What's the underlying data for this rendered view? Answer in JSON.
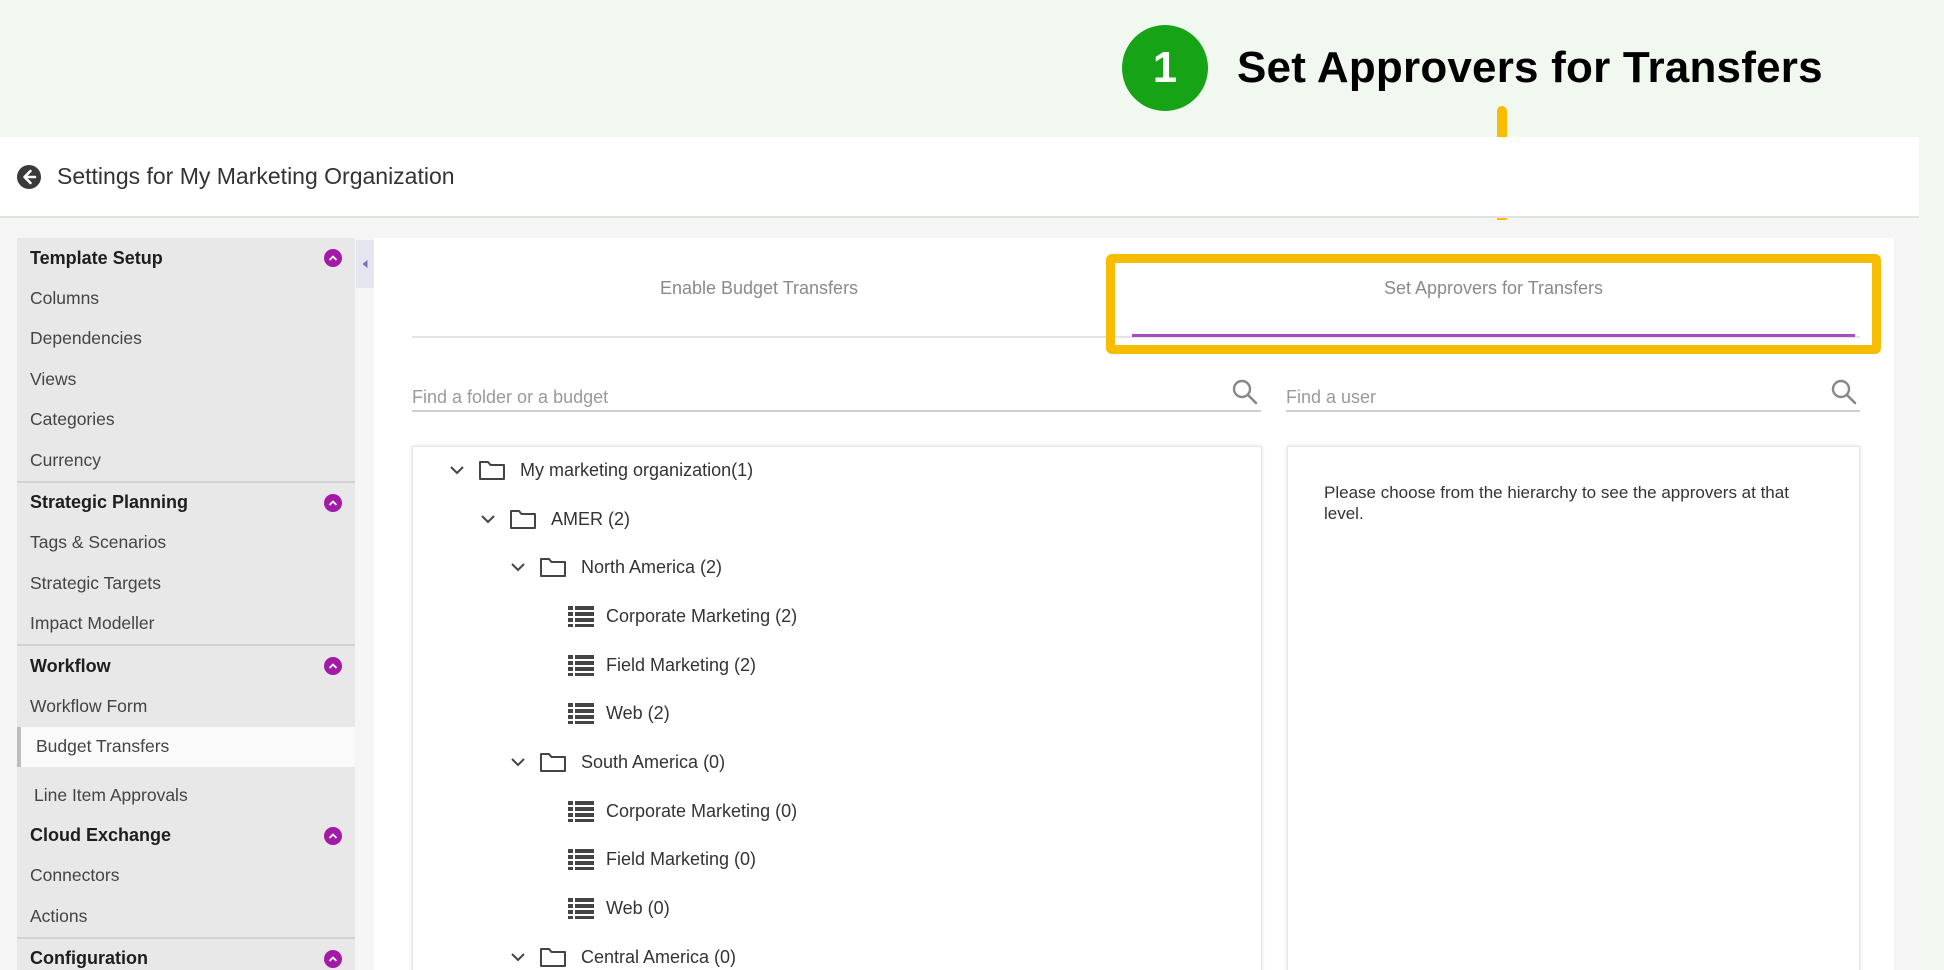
{
  "callout": {
    "number": "1",
    "title": "Set Approvers for Transfers",
    "badge_color": "#16a316",
    "highlight_color": "#f8bc00"
  },
  "header": {
    "back_icon": "back-arrow-circle-icon",
    "title": "Settings for My Marketing Organization"
  },
  "sidebar": {
    "sections": [
      {
        "title": "Template Setup",
        "items": [
          "Columns",
          "Dependencies",
          "Views",
          "Categories",
          "Currency"
        ]
      },
      {
        "title": "Strategic Planning",
        "items": [
          "Tags & Scenarios",
          "Strategic Targets",
          "Impact Modeller"
        ]
      },
      {
        "title": "Workflow",
        "items": [
          "Workflow Form",
          "Budget Transfers",
          "Line Item Approvals"
        ]
      },
      {
        "title": "Cloud Exchange",
        "items": [
          "Connectors",
          "Actions"
        ]
      },
      {
        "title": "Configuration",
        "items": []
      }
    ],
    "active_item": "Budget Transfers",
    "accent_color": "#a319a8"
  },
  "tabs": [
    {
      "label": "Enable Budget Transfers",
      "active": false
    },
    {
      "label": "Set Approvers for Transfers",
      "active": true
    }
  ],
  "search": {
    "folder_placeholder": "Find a folder or a budget",
    "user_placeholder": "Find a user"
  },
  "tree": [
    {
      "label": "My marketing organization(1)",
      "type": "folder",
      "expanded": true
    },
    {
      "label": "AMER (2)",
      "type": "folder",
      "expanded": true
    },
    {
      "label": "North America (2)",
      "type": "folder",
      "expanded": true
    },
    {
      "label": "Corporate Marketing (2)",
      "type": "budget"
    },
    {
      "label": "Field Marketing (2)",
      "type": "budget"
    },
    {
      "label": "Web (2)",
      "type": "budget"
    },
    {
      "label": "South America (0)",
      "type": "folder",
      "expanded": true
    },
    {
      "label": "Corporate Marketing (0)",
      "type": "budget"
    },
    {
      "label": "Field Marketing (0)",
      "type": "budget"
    },
    {
      "label": "Web (0)",
      "type": "budget"
    },
    {
      "label": "Central America (0)",
      "type": "folder",
      "expanded": true
    }
  ],
  "approvers_panel": {
    "message": "Please choose from the hierarchy to see the approvers at that level."
  }
}
